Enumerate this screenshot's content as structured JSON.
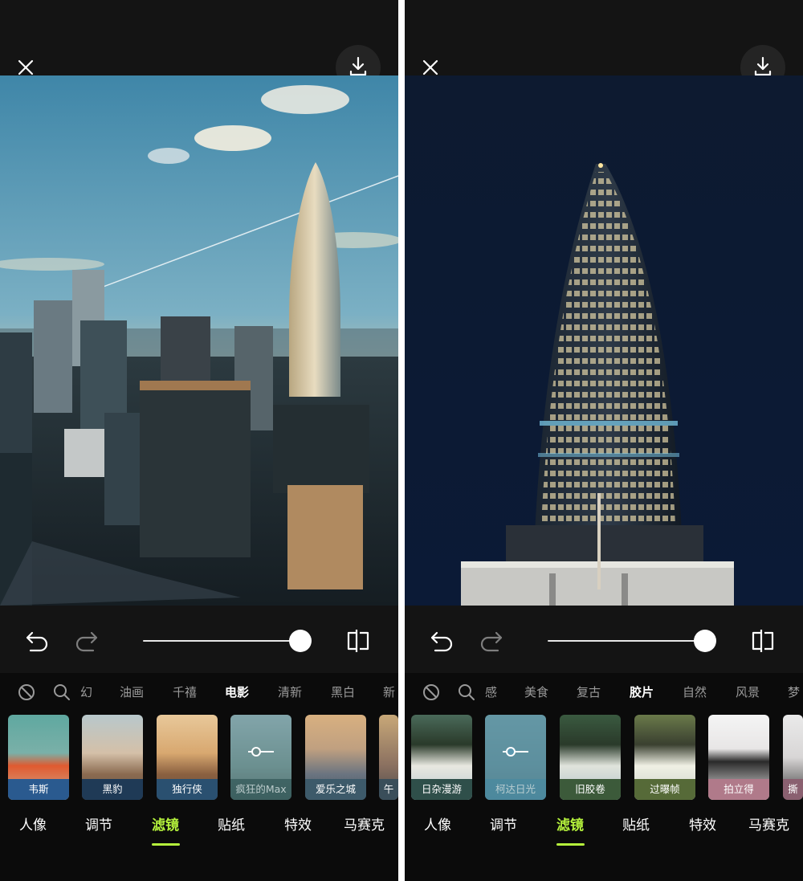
{
  "colors": {
    "accent": "#b5f23c",
    "background": "#141414",
    "panel": "#0b0b0b"
  },
  "screens": [
    {
      "id": "left",
      "slider_value": 1.0,
      "filter_categories": [
        "幻",
        "油画",
        "千禧",
        "电影",
        "清新",
        "黑白",
        "新"
      ],
      "active_category": "电影",
      "filters": [
        {
          "label": "韦斯",
          "label_bg": "#2a5a8f",
          "selected": false
        },
        {
          "label": "黑豹",
          "label_bg": "#1f3a56",
          "selected": false
        },
        {
          "label": "独行侠",
          "label_bg": "#2a5070",
          "selected": false
        },
        {
          "label": "疯狂的Max",
          "label_bg": "#355a5a",
          "selected": true
        },
        {
          "label": "爱乐之城",
          "label_bg": "#3d5a6a",
          "selected": false
        },
        {
          "label": "午",
          "label_bg": "#3a4e5a",
          "selected": false
        }
      ],
      "nav": [
        "人像",
        "调节",
        "滤镜",
        "贴纸",
        "特效",
        "马赛克"
      ],
      "active_nav": "滤镜"
    },
    {
      "id": "right",
      "slider_value": 1.0,
      "filter_categories": [
        "感",
        "美食",
        "复古",
        "胶片",
        "自然",
        "风景",
        "梦"
      ],
      "active_category": "胶片",
      "filters": [
        {
          "label": "日杂漫游",
          "label_bg": "#2f4f4a",
          "selected": false
        },
        {
          "label": "柯达日光",
          "label_bg": "#4a8aa0",
          "selected": true
        },
        {
          "label": "旧胶卷",
          "label_bg": "#3c5a3a",
          "selected": false
        },
        {
          "label": "过曝帧",
          "label_bg": "#566a38",
          "selected": false
        },
        {
          "label": "拍立得",
          "label_bg": "#b07a8a",
          "selected": false
        },
        {
          "label": "撕",
          "label_bg": "#8a6070",
          "selected": false
        }
      ],
      "nav": [
        "人像",
        "调节",
        "滤镜",
        "贴纸",
        "特效",
        "马赛克"
      ],
      "active_nav": "滤镜"
    }
  ]
}
